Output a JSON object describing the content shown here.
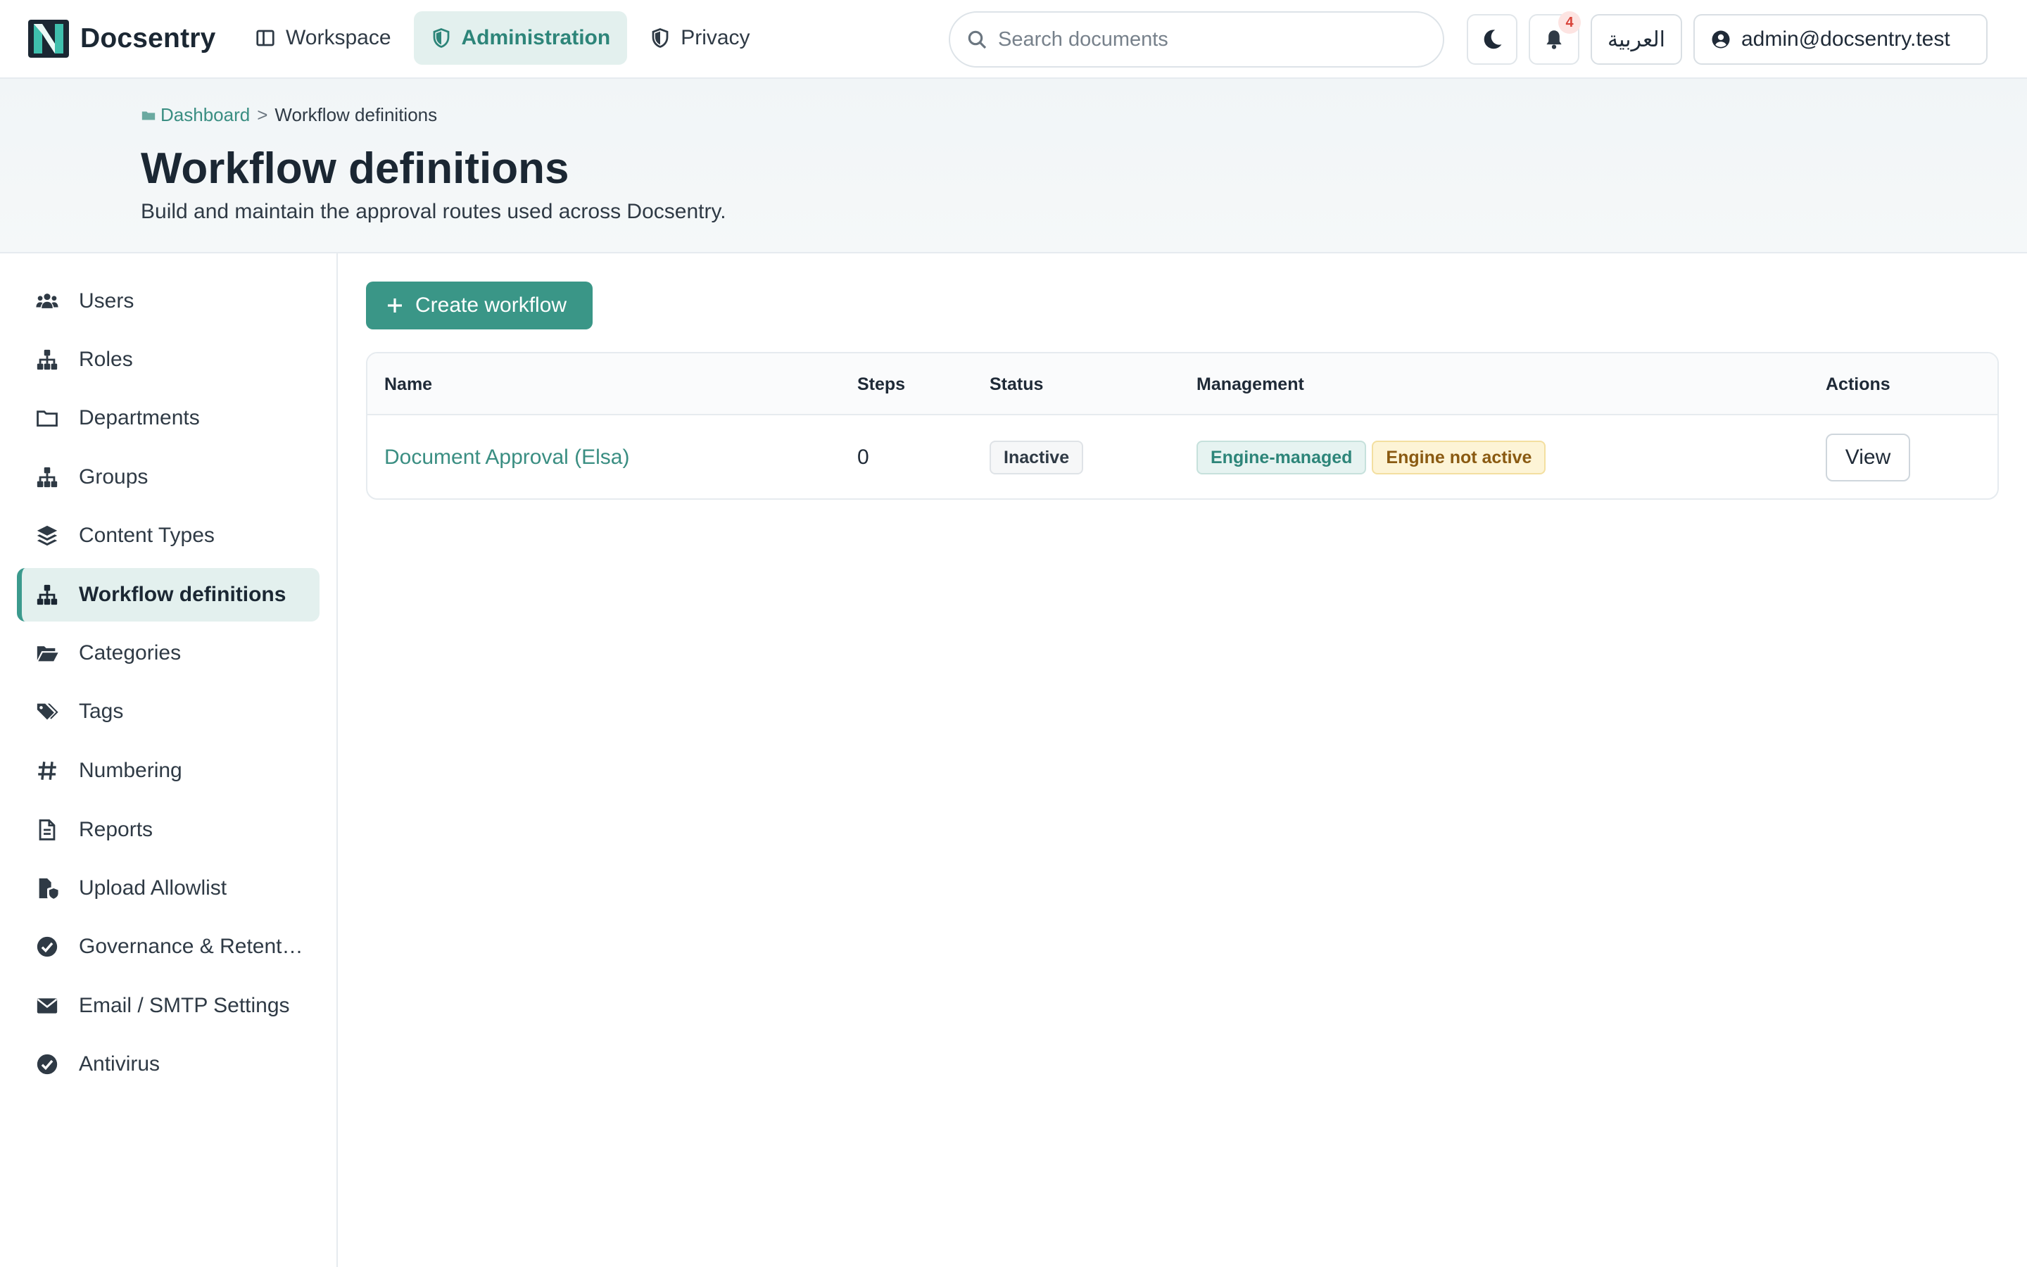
{
  "app": {
    "brand_name": "Docsentry",
    "accent_color": "#3a9687"
  },
  "nav": {
    "items": [
      {
        "label": "Workspace",
        "icon": "workspace-icon"
      },
      {
        "label": "Administration",
        "icon": "shield-icon",
        "active": true
      },
      {
        "label": "Privacy",
        "icon": "shield-icon"
      }
    ]
  },
  "search": {
    "placeholder": "Search documents",
    "value": ""
  },
  "toolbar": {
    "theme_icon": "moon-icon",
    "notifications_icon": "bell-icon",
    "notifications_count": "4",
    "language_label": "العربية",
    "user_label": "admin@docsentry.test"
  },
  "breadcrumb": {
    "home": "Dashboard",
    "separator": ">",
    "current": "Workflow definitions"
  },
  "page": {
    "title": "Workflow definitions",
    "subtitle": "Build and maintain the approval routes used across Docsentry."
  },
  "sidebar": {
    "items": [
      {
        "label": "Users",
        "icon": "users-icon"
      },
      {
        "label": "Roles",
        "icon": "hierarchy-icon"
      },
      {
        "label": "Departments",
        "icon": "folder-icon"
      },
      {
        "label": "Groups",
        "icon": "hierarchy-icon"
      },
      {
        "label": "Content Types",
        "icon": "layers-icon"
      },
      {
        "label": "Workflow definitions",
        "icon": "hierarchy-icon",
        "active": true
      },
      {
        "label": "Categories",
        "icon": "folder-open-icon"
      },
      {
        "label": "Tags",
        "icon": "tags-icon"
      },
      {
        "label": "Numbering",
        "icon": "hash-icon"
      },
      {
        "label": "Reports",
        "icon": "document-icon"
      },
      {
        "label": "Upload Allowlist",
        "icon": "file-shield-icon"
      },
      {
        "label": "Governance & Retent…",
        "icon": "check-circle-icon"
      },
      {
        "label": "Email / SMTP Settings",
        "icon": "envelope-icon"
      },
      {
        "label": "Antivirus",
        "icon": "check-circle-icon"
      }
    ]
  },
  "main": {
    "create_label": "Create workflow",
    "table": {
      "columns": [
        "Name",
        "Steps",
        "Status",
        "Management",
        "Actions"
      ],
      "rows": [
        {
          "name": "Document Approval (Elsa)",
          "steps": "0",
          "status": "Inactive",
          "management": [
            "Engine-managed",
            "Engine not active"
          ],
          "action": "View"
        }
      ]
    }
  }
}
